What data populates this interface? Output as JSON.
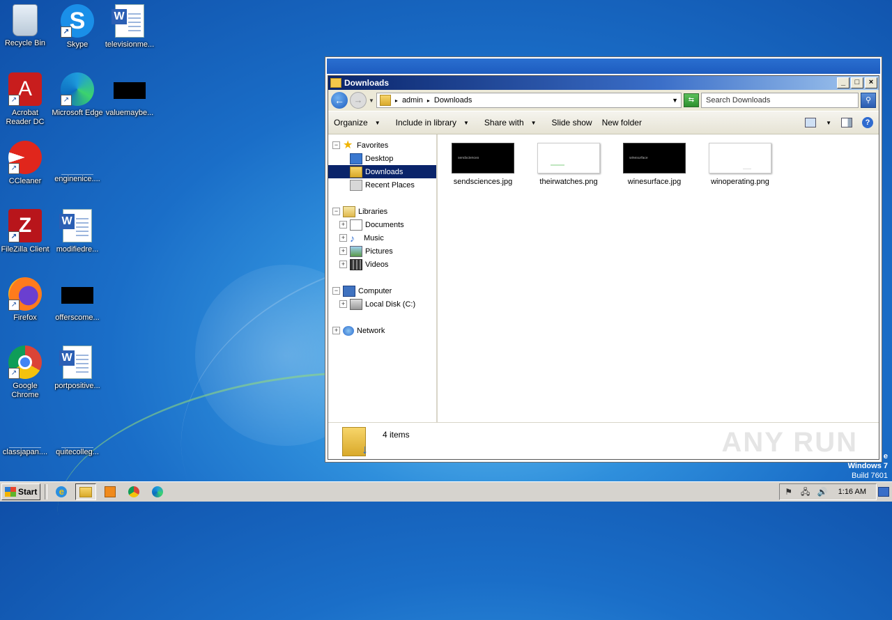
{
  "desktop": {
    "icons": [
      {
        "label": "Recycle Bin",
        "icon": "recycle-bin-icon"
      },
      {
        "label": "Skype",
        "icon": "skype-icon"
      },
      {
        "label": "televisionme...",
        "icon": "word-document-icon"
      },
      {
        "label": "Acrobat Reader DC",
        "icon": "acrobat-icon"
      },
      {
        "label": "Microsoft Edge",
        "icon": "edge-icon"
      },
      {
        "label": "valuemaybe...",
        "icon": "image-file-icon"
      },
      {
        "label": "CCleaner",
        "icon": "ccleaner-icon"
      },
      {
        "label": "enginenice....",
        "icon": "file-icon"
      },
      {
        "label": "FileZilla Client",
        "icon": "filezilla-icon"
      },
      {
        "label": "modifiedre...",
        "icon": "word-document-icon"
      },
      {
        "label": "Firefox",
        "icon": "firefox-icon"
      },
      {
        "label": "offerscome...",
        "icon": "image-file-icon"
      },
      {
        "label": "Google Chrome",
        "icon": "chrome-icon"
      },
      {
        "label": "portpositive...",
        "icon": "word-document-icon"
      },
      {
        "label": "classjapan....",
        "icon": "file-icon"
      },
      {
        "label": "quitecolleg...",
        "icon": "file-icon"
      }
    ],
    "os_info": {
      "edition_tail": "e",
      "name": "Windows 7",
      "build": "Build 7601"
    }
  },
  "explorer": {
    "title": "Downloads",
    "breadcrumb": [
      "admin",
      "Downloads"
    ],
    "search_placeholder": "Search Downloads",
    "toolbar": {
      "organize": "Organize",
      "include_in_library": "Include in library",
      "share_with": "Share with",
      "slide_show": "Slide show",
      "new_folder": "New folder"
    },
    "nav": {
      "favorites": "Favorites",
      "desktop": "Desktop",
      "downloads": "Downloads",
      "recent_places": "Recent Places",
      "libraries": "Libraries",
      "documents": "Documents",
      "music": "Music",
      "pictures": "Pictures",
      "videos": "Videos",
      "computer": "Computer",
      "local_disk": "Local Disk (C:)",
      "network": "Network"
    },
    "files": [
      {
        "name": "sendsciences.jpg",
        "thumb_text": "sendsciences"
      },
      {
        "name": "theirwatches.png",
        "thumb_text": ""
      },
      {
        "name": "winesurface.jpg",
        "thumb_text": "winesurface"
      },
      {
        "name": "winoperating.png",
        "thumb_text": ""
      }
    ],
    "status": "4 items",
    "watermark": "ANY RUN"
  },
  "taskbar": {
    "start_label": "Start",
    "clock": "1:16 AM"
  }
}
